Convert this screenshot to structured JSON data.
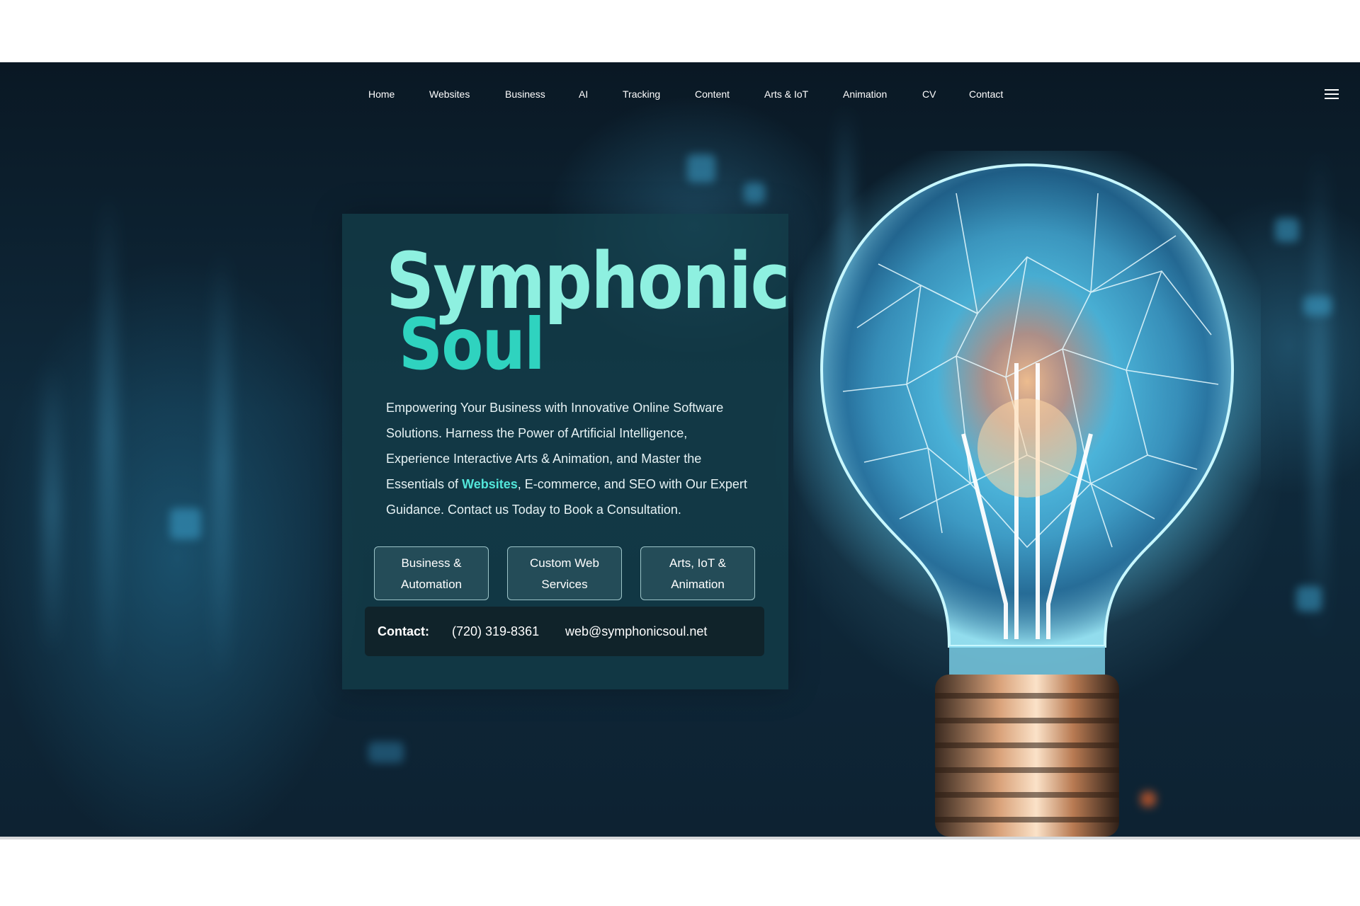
{
  "nav": {
    "items": [
      {
        "label": "Home"
      },
      {
        "label": "Websites"
      },
      {
        "label": "Business"
      },
      {
        "label": "AI"
      },
      {
        "label": "Tracking"
      },
      {
        "label": "Content"
      },
      {
        "label": "Arts & IoT"
      },
      {
        "label": "Animation"
      },
      {
        "label": "CV"
      },
      {
        "label": "Contact"
      }
    ],
    "menu_icon": "hamburger-menu-icon"
  },
  "hero": {
    "logo": {
      "line1": "Symphonic",
      "line2": "Soul"
    },
    "description": {
      "part1": "Empowering Your Business with Innovative Online Software Solutions. Harness the Power of Artificial Intelligence, Experience Interactive Arts & Animation, and Master the Essentials of ",
      "highlight": "Websites",
      "part2": ", E-commerce, and SEO with Our Expert Guidance. Contact us Today to Book a Consultation."
    },
    "buttons": [
      {
        "line1": "Business &",
        "line2": "Automation"
      },
      {
        "line1": "Custom Web",
        "line2": "Services"
      },
      {
        "line1": "Arts, IoT &",
        "line2": "Animation"
      }
    ],
    "contact": {
      "label": "Contact:",
      "phone": "(720) 319-8361",
      "email": "web@symphonicsoul.net"
    }
  },
  "colors": {
    "accent": "#52e6da",
    "logo_light": "#8ef0e0",
    "logo_dark": "#2fd3bf",
    "background": "#0f2a3c"
  }
}
